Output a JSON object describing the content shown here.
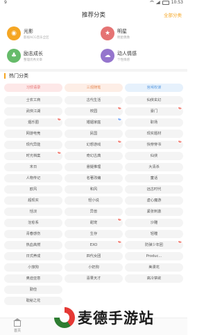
{
  "status_bar": {
    "left": "9",
    "time": "10:53"
  },
  "header": {
    "title": "推荐分类",
    "all_link": "全部分类"
  },
  "features": [
    {
      "title": "光影",
      "subtitle": "影视ACG音乐全区",
      "icon": "camera-icon",
      "color": "#f5a623"
    },
    {
      "title": "明星",
      "subtitle": "明星偶像",
      "icon": "star-person-icon",
      "color": "#e57373"
    },
    {
      "title": "励志成长",
      "subtitle": "整理优秀文章",
      "icon": "growth-icon",
      "color": "#66bb6a"
    },
    {
      "title": "动人情感",
      "subtitle": "个性情感",
      "icon": "heart-emotion-icon",
      "color": "#9575cd"
    }
  ],
  "section_title": "热门分类",
  "columns": [
    {
      "header": "习惯语录",
      "items": [
        "士农工商",
        "武侠江湖",
        "烟乐圈",
        "网游电竞",
        "现代异能",
        "时光档案",
        "末日",
        "人物传记",
        "欧风",
        "超现实",
        "恬淡",
        "治愈系",
        "青春感伤",
        "热血高燃",
        "日式养成",
        "小旅狗",
        "奥迪亚意",
        "勤俭",
        "耽秘之花"
      ]
    },
    {
      "header": "三观随笔",
      "items": [
        "古代生活",
        "校园",
        "婚姻家庭",
        "民国",
        "幻想游戏",
        "奇幻古典",
        "悬疑推理",
        "名著改编",
        "和风",
        "轻小说",
        "异兽",
        "甜宠",
        "生存",
        "EXO",
        "四代女团",
        "小奶狗",
        "喜果天才"
      ]
    },
    {
      "header": "宫闱权谋",
      "items": [
        "仙侠玄幻",
        "豪门",
        "职场",
        "现实题材",
        "快穿穿书",
        "仙侠",
        "大清杀",
        "童话",
        "远古时代",
        "虚心魔游",
        "紧张刺激",
        "沙雕",
        "轻瞳",
        "防弹少年团",
        "Produc...",
        "美漫花",
        "高冷禁欲"
      ]
    }
  ],
  "bottom_nav": {
    "home_label": "首页"
  },
  "watermark": {
    "text": "麦德手游站"
  }
}
